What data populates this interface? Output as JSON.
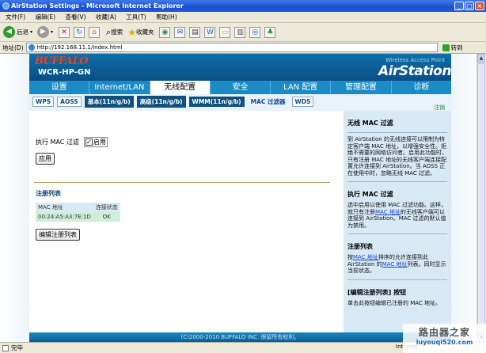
{
  "window": {
    "title": "AirStation Settings - Microsoft Internet Explorer"
  },
  "menu": [
    "文件(F)",
    "编辑(E)",
    "查看(V)",
    "收藏(A)",
    "工具(T)",
    "帮助(H)"
  ],
  "toolbar": {
    "back": "后退",
    "search": "搜索",
    "favorites": "收藏夹"
  },
  "address": {
    "label": "地址(D)",
    "url": "http://192.168.11.1/index.html",
    "go": "转到"
  },
  "header": {
    "logo": "BUFFALO",
    "model": "WCR-HP-GN",
    "wap": "Wireless Access Point",
    "brand": "AirStation"
  },
  "tabs": [
    "设置",
    "Internet/LAN",
    "无线配置",
    "安全",
    "LAN 配置",
    "管理配置",
    "诊断"
  ],
  "subtabs": [
    "WPS",
    "AOSS",
    "基本(11n/g/b)",
    "高级(11n/g/b)",
    "WMM(11n/g/b)",
    "MAC 过滤器",
    "WDS"
  ],
  "logout": "注销",
  "form": {
    "enforce_label": "执行 MAC 过滤",
    "enable_label": "启用",
    "apply": "应用"
  },
  "registration": {
    "title": "注册列表",
    "headers": [
      "MAC 地址",
      "连接状态"
    ],
    "rows": [
      [
        "00:24:A5:A3:7E:1D",
        "OK"
      ]
    ],
    "edit_button": "编辑注册列表"
  },
  "help": {
    "s1_title": "无线 MAC 过滤",
    "s1_text": "到 AirStation 的无线连接可以限制为特定客户端 MAC 地址，以增强安全性。拒绝不需要的网络访问者。启用此功能时，只有注册 MAC 地址的无线客户端连接配置允许连接到 AirStation。当 AOSS 正在使用中时，忽略无线 MAC 过滤。",
    "s2_title": "执行 MAC 过滤",
    "s2_a": "选中启用以使用 MAC 过滤功能。这样，就只有注册",
    "s2_link": "MAC 地址",
    "s2_b": "的无线客户端可以连接到 AirStation。MAC 过滤的默认值为禁用。",
    "s3_title": "注册列表",
    "s3_a": "按",
    "s3_link1": "MAC 地址",
    "s3_b": "排序的允许连接到此 AirStation 的",
    "s3_link2": "MAC 地址",
    "s3_c": "列表。同时显示当前状态。",
    "s4_title": "[编辑注册列表] 按钮",
    "s4_text": "单击此按钮编辑已注册的 MAC 地址。"
  },
  "footer": "(C)2000-2010 BUFFALO INC. 保留所有权利。",
  "status": {
    "done": "完毕",
    "zone": "Internet"
  },
  "watermark": {
    "line1": "路由器之家",
    "line2": "luyouqi520.com"
  }
}
